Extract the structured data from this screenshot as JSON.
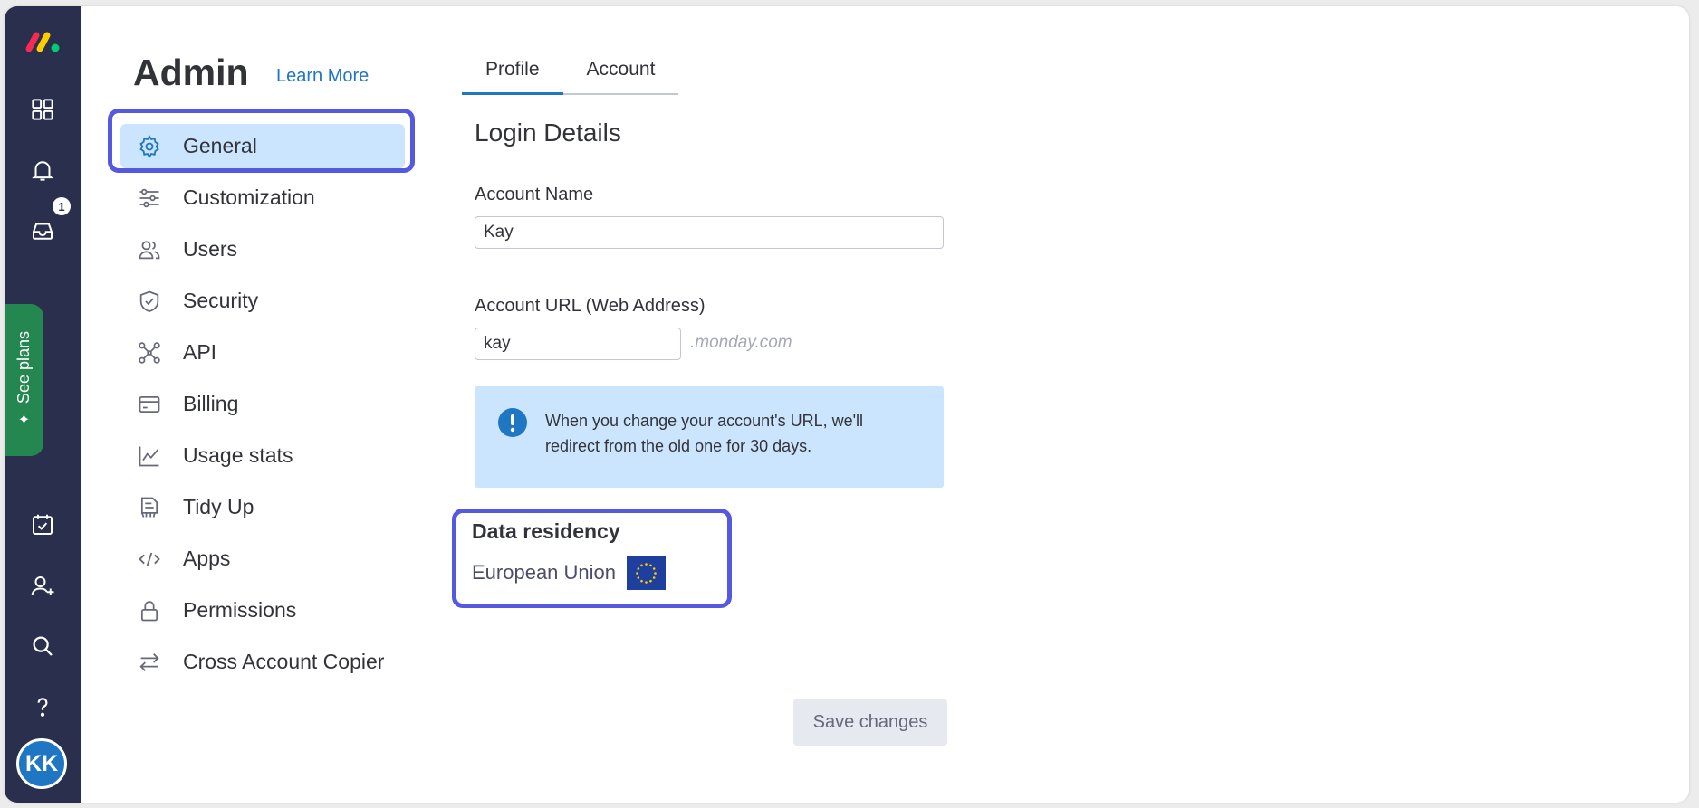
{
  "app": {
    "notification_count": "1",
    "see_plans_label": "See plans",
    "avatar_initials": "KK",
    "brand_colors": {
      "rail": "#292f4c",
      "accent": "#1f76c2",
      "highlight": "#5559df",
      "active_bg": "#cce5ff",
      "plans": "#258750"
    }
  },
  "rail": {
    "top_icons": [
      "home-grid-icon",
      "bell-icon",
      "inbox-icon"
    ],
    "bottom_icons": [
      "my-work-icon",
      "invite-icon",
      "search-icon",
      "help-icon"
    ]
  },
  "header": {
    "title": "Admin",
    "learn_more": "Learn More"
  },
  "menu": {
    "items": [
      {
        "label": "General",
        "icon": "gear-icon",
        "active": true
      },
      {
        "label": "Customization",
        "icon": "sliders-icon"
      },
      {
        "label": "Users",
        "icon": "users-icon"
      },
      {
        "label": "Security",
        "icon": "shield-icon"
      },
      {
        "label": "API",
        "icon": "api-icon"
      },
      {
        "label": "Billing",
        "icon": "credit-card-icon"
      },
      {
        "label": "Usage stats",
        "icon": "chart-icon"
      },
      {
        "label": "Tidy Up",
        "icon": "tidy-icon"
      },
      {
        "label": "Apps",
        "icon": "code-icon"
      },
      {
        "label": "Permissions",
        "icon": "lock-icon"
      },
      {
        "label": "Cross Account Copier",
        "icon": "arrows-icon"
      }
    ]
  },
  "tabs": [
    {
      "label": "Profile",
      "active": true
    },
    {
      "label": "Account",
      "active": false
    }
  ],
  "login_details": {
    "title": "Login Details",
    "account_name_label": "Account Name",
    "account_name_value": "Kay",
    "account_url_label": "Account URL (Web Address)",
    "account_url_value": "kay",
    "url_suffix": ".monday.com",
    "info_text": "When you change your account's URL, we'll redirect from the old one for 30 days."
  },
  "data_residency": {
    "title": "Data residency",
    "value": "European Union",
    "flag_icon": "eu-flag-icon"
  },
  "actions": {
    "save_label": "Save changes"
  }
}
